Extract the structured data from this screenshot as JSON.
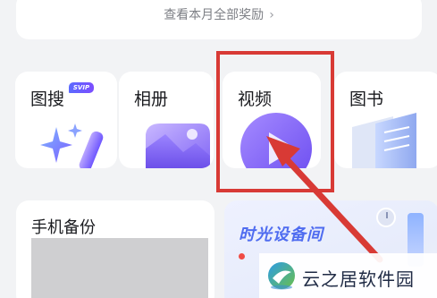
{
  "top_card": {
    "link_text": "查看本月全部奖励",
    "chevron": "›"
  },
  "tiles": [
    {
      "id": "search",
      "label": "图搜",
      "badge": "SVIP",
      "icon": "sparkle-icon"
    },
    {
      "id": "album",
      "label": "相册",
      "icon": "photo-album-icon"
    },
    {
      "id": "video",
      "label": "视频",
      "icon": "video-play-icon"
    },
    {
      "id": "books",
      "label": "图书",
      "icon": "book-icon"
    }
  ],
  "backup": {
    "label": "手机备份"
  },
  "time_room": {
    "title": "时光设备间"
  },
  "watermark": {
    "text": "云之居软件园"
  },
  "colors": {
    "highlight": "#d83a35",
    "accent": "#4f6cf0",
    "background": "#f2f3f5"
  }
}
